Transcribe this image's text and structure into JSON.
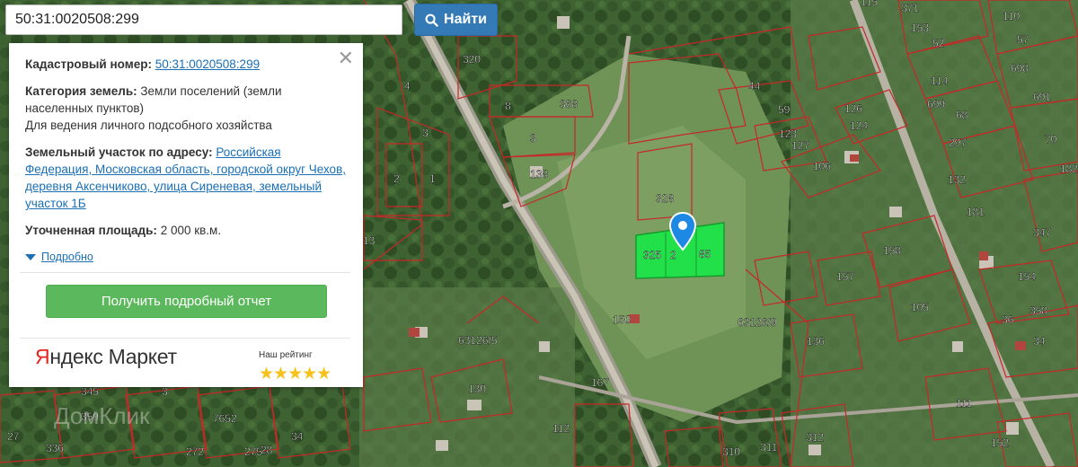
{
  "search": {
    "value": "50:31:0020508:299",
    "button_label": "Найти"
  },
  "panel": {
    "cadastral_label": "Кадастровый номер:",
    "cadastral_value": "50:31:0020508:299",
    "category_label": "Категория земель:",
    "category_value": "Земли поселений (земли населенных пунктов)",
    "usage": "Для ведения личного подсобного хозяйства",
    "address_label": "Земельный участок по адресу:",
    "address_value": "Российская Федерация, Московская область, городской округ Чехов, деревня Аксенчиково, улица Сиреневая, земельный участок 1Б",
    "area_label": "Уточненная площадь:",
    "area_value": "2 000 кв.м.",
    "more_label": "Подробно",
    "report_button": "Получить подробный отчет",
    "brand_ya": "Я",
    "brand_rest": "ндекс Маркет",
    "rating_label": "Наш рейтинг",
    "stars": "★★★★★"
  },
  "map": {
    "watermark": "ДомКлик",
    "parcel_labels": [
      "320",
      "4",
      "8",
      "368",
      "3",
      "3",
      "138",
      "2",
      "1",
      "13",
      "44",
      "59",
      "126",
      "123",
      "127",
      "124",
      "106",
      "328",
      "325",
      "2",
      "85",
      "115",
      "371",
      "110",
      "153",
      "52",
      "57",
      "114",
      "698",
      "691",
      "699",
      "68",
      "70",
      "297",
      "132",
      "182",
      "181",
      "347",
      "158",
      "154",
      "157",
      "105",
      "358",
      "36",
      "34",
      "63126/9",
      "136",
      "63126/5",
      "130",
      "150",
      "167",
      "345",
      "359",
      "27",
      "112",
      "111",
      "152",
      "312",
      "311",
      "310",
      "275",
      "272",
      "336",
      "34",
      "7652",
      "28",
      "3"
    ],
    "colors": {
      "parcel_border": "#c62828",
      "selected_fill": "#22e04a",
      "pin": "#1e88e5"
    }
  }
}
